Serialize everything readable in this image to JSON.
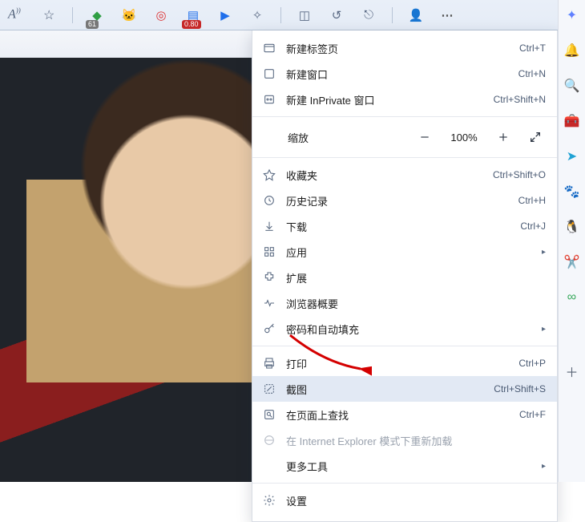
{
  "toolbar": {
    "reading_badge": "61",
    "notes_badge": "0.80"
  },
  "menu": {
    "new_tab": {
      "label": "新建标签页",
      "shortcut": "Ctrl+T"
    },
    "new_win": {
      "label": "新建窗口",
      "shortcut": "Ctrl+N"
    },
    "inprivate": {
      "label": "新建 InPrivate 窗口",
      "shortcut": "Ctrl+Shift+N"
    },
    "zoom": {
      "label": "缩放",
      "value": "100%"
    },
    "favorites": {
      "label": "收藏夹",
      "shortcut": "Ctrl+Shift+O"
    },
    "history": {
      "label": "历史记录",
      "shortcut": "Ctrl+H"
    },
    "downloads": {
      "label": "下载",
      "shortcut": "Ctrl+J"
    },
    "apps": {
      "label": "应用"
    },
    "extensions": {
      "label": "扩展"
    },
    "essentials": {
      "label": "浏览器概要"
    },
    "passwords": {
      "label": "密码和自动填充"
    },
    "print": {
      "label": "打印",
      "shortcut": "Ctrl+P"
    },
    "screenshot": {
      "label": "截图",
      "shortcut": "Ctrl+Shift+S"
    },
    "find": {
      "label": "在页面上查找",
      "shortcut": "Ctrl+F"
    },
    "ie_mode": {
      "label": "在 Internet Explorer 模式下重新加载"
    },
    "more_tools": {
      "label": "更多工具"
    },
    "settings": {
      "label": "设置"
    }
  }
}
